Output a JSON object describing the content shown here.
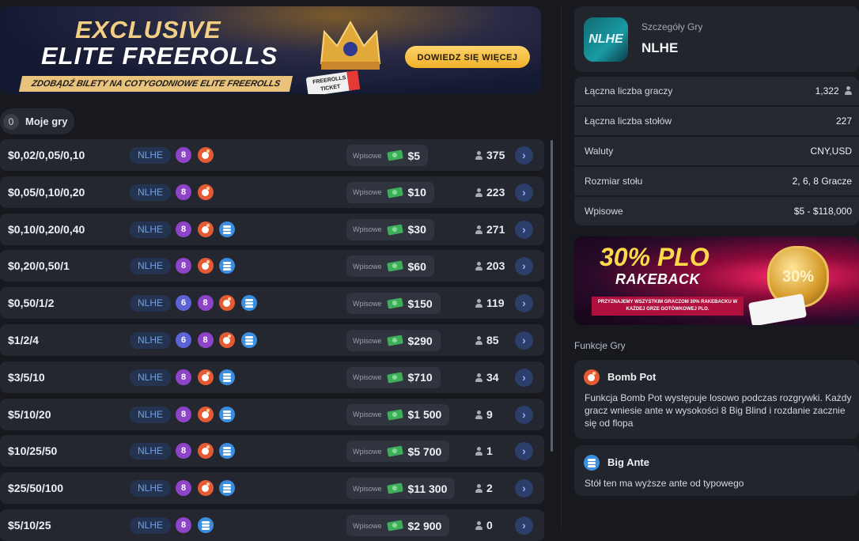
{
  "banner": {
    "title_line1": "EXCLUSIVE",
    "title_line2": "ELITE FREEROLLS",
    "ribbon": "ZDOBĄDŹ BILETY NA COTYGODNIOWE ELITE FREEROLLS",
    "cta": "DOWIEDZ SIĘ WIĘCEJ",
    "ticket": "FREEROLLS TICKET"
  },
  "my_games": {
    "count": "0",
    "label": "Moje gry"
  },
  "tables": [
    {
      "stakes": "$0,02/0,05/0,10",
      "game": "NLHE",
      "badges": [
        "8",
        "bomb"
      ],
      "buyin_label": "Wpisowe",
      "buyin": "$5",
      "players": "375"
    },
    {
      "stakes": "$0,05/0,10/0,20",
      "game": "NLHE",
      "badges": [
        "8",
        "bomb"
      ],
      "buyin_label": "Wpisowe",
      "buyin": "$10",
      "players": "223"
    },
    {
      "stakes": "$0,10/0,20/0,40",
      "game": "NLHE",
      "badges": [
        "8",
        "bomb",
        "ante"
      ],
      "buyin_label": "Wpisowe",
      "buyin": "$30",
      "players": "271"
    },
    {
      "stakes": "$0,20/0,50/1",
      "game": "NLHE",
      "badges": [
        "8",
        "bomb",
        "ante"
      ],
      "buyin_label": "Wpisowe",
      "buyin": "$60",
      "players": "203"
    },
    {
      "stakes": "$0,50/1/2",
      "game": "NLHE",
      "badges": [
        "6",
        "8",
        "bomb",
        "ante"
      ],
      "buyin_label": "Wpisowe",
      "buyin": "$150",
      "players": "119"
    },
    {
      "stakes": "$1/2/4",
      "game": "NLHE",
      "badges": [
        "6",
        "8",
        "bomb",
        "ante"
      ],
      "buyin_label": "Wpisowe",
      "buyin": "$290",
      "players": "85"
    },
    {
      "stakes": "$3/5/10",
      "game": "NLHE",
      "badges": [
        "8",
        "bomb",
        "ante"
      ],
      "buyin_label": "Wpisowe",
      "buyin": "$710",
      "players": "34"
    },
    {
      "stakes": "$5/10/20",
      "game": "NLHE",
      "badges": [
        "8",
        "bomb",
        "ante"
      ],
      "buyin_label": "Wpisowe",
      "buyin": "$1 500",
      "players": "9"
    },
    {
      "stakes": "$10/25/50",
      "game": "NLHE",
      "badges": [
        "8",
        "bomb",
        "ante"
      ],
      "buyin_label": "Wpisowe",
      "buyin": "$5 700",
      "players": "1"
    },
    {
      "stakes": "$25/50/100",
      "game": "NLHE",
      "badges": [
        "8",
        "bomb",
        "ante"
      ],
      "buyin_label": "Wpisowe",
      "buyin": "$11 300",
      "players": "2"
    },
    {
      "stakes": "$5/10/25",
      "game": "NLHE",
      "badges": [
        "8",
        "ante"
      ],
      "buyin_label": "Wpisowe",
      "buyin": "$2 900",
      "players": "0"
    }
  ],
  "game_details": {
    "logo_text": "NLHE",
    "subtitle": "Szczegóły Gry",
    "name": "NLHE",
    "rows": [
      {
        "key": "Łączna liczba graczy",
        "value": "1,322"
      },
      {
        "key": "Łączna liczba stołów",
        "value": "227"
      },
      {
        "key": "Waluty",
        "value": "CNY,USD"
      },
      {
        "key": "Rozmiar stołu",
        "value": "2, 6, 8 Gracze"
      },
      {
        "key": "Wpisowe",
        "value": "$5 - $118,000"
      }
    ]
  },
  "promo": {
    "line1": "30% PLO",
    "line2": "RAKEBACK",
    "line3": "PRZYZNAJEMY WSZYSTKIM GRACZOM 30% RAKEBACKU W KAŻDEJ GRZE GOTÓWKOWEJ PLO.",
    "coin": "30%"
  },
  "features": {
    "title": "Funkcje Gry",
    "items": [
      {
        "name": "Bomb Pot",
        "desc": "Funkcja Bomb Pot występuje losowo podczas rozgrywki. Każdy gracz wniesie ante w wysokości 8 Big Blind i rozdanie  zacznie się od flopa"
      },
      {
        "name": "Big Ante",
        "desc": "Stół ten ma wyższe ante od typowego"
      }
    ]
  }
}
